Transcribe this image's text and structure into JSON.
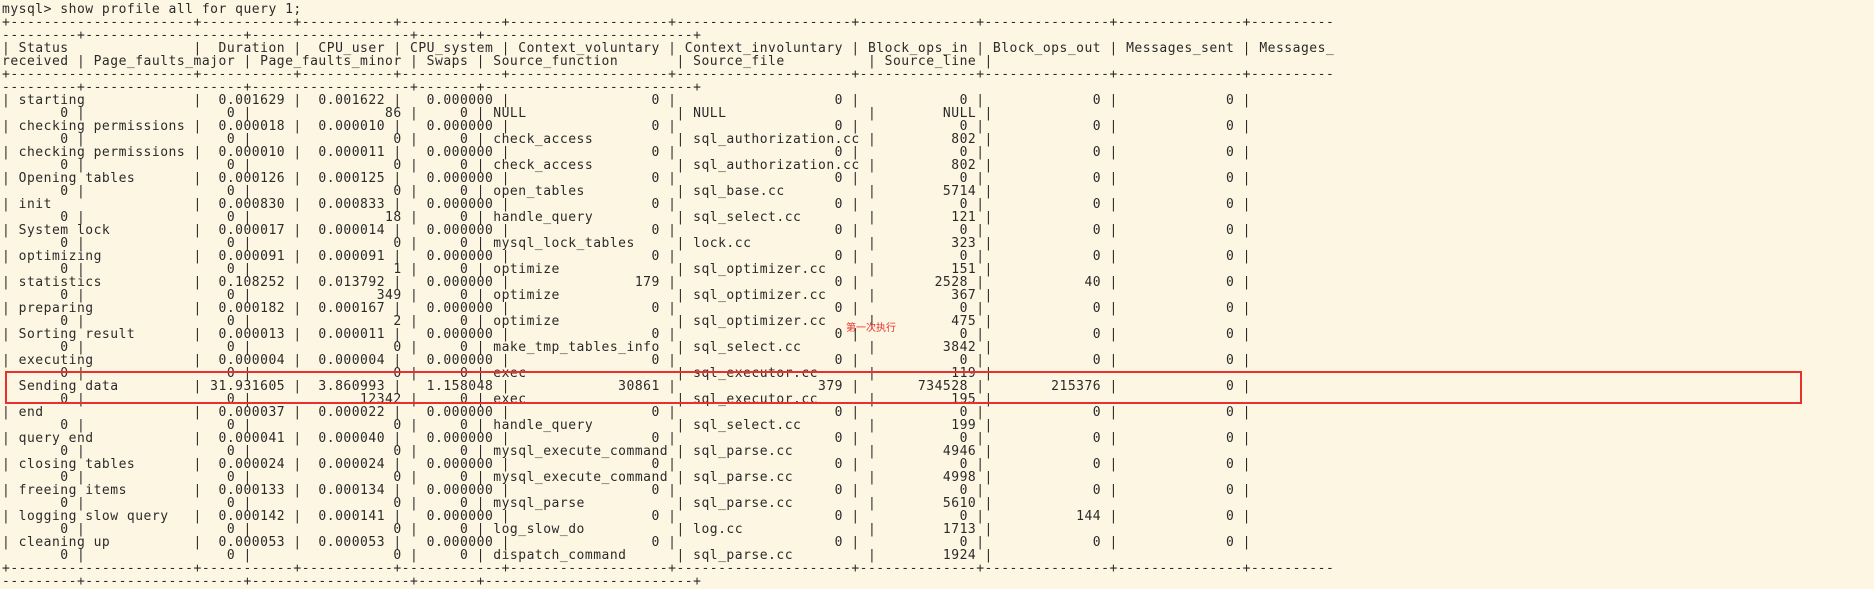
{
  "prompt": "mysql>",
  "command": "show profile all for query 1;",
  "separator": "+----------------------+-----------+-----------+------------+-------------------+---------------------+--------------+---------------+---------------+-------------------+-------------------+-------------------+-------+-------------------------+",
  "headers": [
    "Status",
    "Duration",
    "CPU_user",
    "CPU_system",
    "Context_voluntary",
    "Context_involuntary",
    "Block_ops_in",
    "Block_ops_out",
    "Messages_sent",
    "Messages_received",
    "Page_faults_major",
    "Page_faults_minor",
    "Swaps",
    "Source_function",
    "Source_file",
    "Source_line"
  ],
  "rows": [
    {
      "status": "starting",
      "duration": "0.001629",
      "cpu_user": "0.001622",
      "cpu_system": "0.000000",
      "ctx_vol": "0",
      "ctx_invol": "0",
      "block_in": "0",
      "block_out": "0",
      "msg_sent": "0",
      "msg_recv": "0",
      "pf_major": "0",
      "pf_minor": "86",
      "swaps": "0",
      "source_function": "NULL",
      "source_file": "NULL",
      "source_line": "NULL"
    },
    {
      "status": "checking permissions",
      "duration": "0.000018",
      "cpu_user": "0.000010",
      "cpu_system": "0.000000",
      "ctx_vol": "0",
      "ctx_invol": "0",
      "block_in": "0",
      "block_out": "0",
      "msg_sent": "0",
      "msg_recv": "0",
      "pf_major": "0",
      "pf_minor": "0",
      "swaps": "0",
      "source_function": "check_access",
      "source_file": "sql_authorization.cc",
      "source_line": "802"
    },
    {
      "status": "checking permissions",
      "duration": "0.000010",
      "cpu_user": "0.000011",
      "cpu_system": "0.000000",
      "ctx_vol": "0",
      "ctx_invol": "0",
      "block_in": "0",
      "block_out": "0",
      "msg_sent": "0",
      "msg_recv": "0",
      "pf_major": "0",
      "pf_minor": "0",
      "swaps": "0",
      "source_function": "check_access",
      "source_file": "sql_authorization.cc",
      "source_line": "802"
    },
    {
      "status": "Opening tables",
      "duration": "0.000126",
      "cpu_user": "0.000125",
      "cpu_system": "0.000000",
      "ctx_vol": "0",
      "ctx_invol": "0",
      "block_in": "0",
      "block_out": "0",
      "msg_sent": "0",
      "msg_recv": "0",
      "pf_major": "0",
      "pf_minor": "0",
      "swaps": "0",
      "source_function": "open_tables",
      "source_file": "sql_base.cc",
      "source_line": "5714"
    },
    {
      "status": "init",
      "duration": "0.000830",
      "cpu_user": "0.000833",
      "cpu_system": "0.000000",
      "ctx_vol": "0",
      "ctx_invol": "0",
      "block_in": "0",
      "block_out": "0",
      "msg_sent": "0",
      "msg_recv": "0",
      "pf_major": "0",
      "pf_minor": "18",
      "swaps": "0",
      "source_function": "handle_query",
      "source_file": "sql_select.cc",
      "source_line": "121"
    },
    {
      "status": "System lock",
      "duration": "0.000017",
      "cpu_user": "0.000014",
      "cpu_system": "0.000000",
      "ctx_vol": "0",
      "ctx_invol": "0",
      "block_in": "0",
      "block_out": "0",
      "msg_sent": "0",
      "msg_recv": "0",
      "pf_major": "0",
      "pf_minor": "0",
      "swaps": "0",
      "source_function": "mysql_lock_tables",
      "source_file": "lock.cc",
      "source_line": "323"
    },
    {
      "status": "optimizing",
      "duration": "0.000091",
      "cpu_user": "0.000091",
      "cpu_system": "0.000000",
      "ctx_vol": "0",
      "ctx_invol": "0",
      "block_in": "0",
      "block_out": "0",
      "msg_sent": "0",
      "msg_recv": "0",
      "pf_major": "0",
      "pf_minor": "1",
      "swaps": "0",
      "source_function": "optimize",
      "source_file": "sql_optimizer.cc",
      "source_line": "151"
    },
    {
      "status": "statistics",
      "duration": "0.108252",
      "cpu_user": "0.013792",
      "cpu_system": "0.000000",
      "ctx_vol": "179",
      "ctx_invol": "0",
      "block_in": "2528",
      "block_out": "40",
      "msg_sent": "0",
      "msg_recv": "0",
      "pf_major": "0",
      "pf_minor": "349",
      "swaps": "0",
      "source_function": "optimize",
      "source_file": "sql_optimizer.cc",
      "source_line": "367"
    },
    {
      "status": "preparing",
      "duration": "0.000182",
      "cpu_user": "0.000167",
      "cpu_system": "0.000000",
      "ctx_vol": "0",
      "ctx_invol": "0",
      "block_in": "0",
      "block_out": "0",
      "msg_sent": "0",
      "msg_recv": "0",
      "pf_major": "0",
      "pf_minor": "2",
      "swaps": "0",
      "source_function": "optimize",
      "source_file": "sql_optimizer.cc",
      "source_line": "475"
    },
    {
      "status": "Sorting result",
      "duration": "0.000013",
      "cpu_user": "0.000011",
      "cpu_system": "0.000000",
      "ctx_vol": "0",
      "ctx_invol": "0",
      "block_in": "0",
      "block_out": "0",
      "msg_sent": "0",
      "msg_recv": "0",
      "pf_major": "0",
      "pf_minor": "0",
      "swaps": "0",
      "source_function": "make_tmp_tables_info",
      "source_file": "sql_select.cc",
      "source_line": "3842"
    },
    {
      "status": "executing",
      "duration": "0.000004",
      "cpu_user": "0.000004",
      "cpu_system": "0.000000",
      "ctx_vol": "0",
      "ctx_invol": "0",
      "block_in": "0",
      "block_out": "0",
      "msg_sent": "0",
      "msg_recv": "0",
      "pf_major": "0",
      "pf_minor": "0",
      "swaps": "0",
      "source_function": "exec",
      "source_file": "sql_executor.cc",
      "source_line": "119"
    },
    {
      "status": "Sending data",
      "duration": "31.931605",
      "cpu_user": "3.860993",
      "cpu_system": "1.158048",
      "ctx_vol": "30861",
      "ctx_invol": "379",
      "block_in": "734528",
      "block_out": "215376",
      "msg_sent": "0",
      "msg_recv": "0",
      "pf_major": "0",
      "pf_minor": "12342",
      "swaps": "0",
      "source_function": "exec",
      "source_file": "sql_executor.cc",
      "source_line": "195"
    },
    {
      "status": "end",
      "duration": "0.000037",
      "cpu_user": "0.000022",
      "cpu_system": "0.000000",
      "ctx_vol": "0",
      "ctx_invol": "0",
      "block_in": "0",
      "block_out": "0",
      "msg_sent": "0",
      "msg_recv": "0",
      "pf_major": "0",
      "pf_minor": "0",
      "swaps": "0",
      "source_function": "handle_query",
      "source_file": "sql_select.cc",
      "source_line": "199"
    },
    {
      "status": "query end",
      "duration": "0.000041",
      "cpu_user": "0.000040",
      "cpu_system": "0.000000",
      "ctx_vol": "0",
      "ctx_invol": "0",
      "block_in": "0",
      "block_out": "0",
      "msg_sent": "0",
      "msg_recv": "0",
      "pf_major": "0",
      "pf_minor": "0",
      "swaps": "0",
      "source_function": "mysql_execute_command",
      "source_file": "sql_parse.cc",
      "source_line": "4946"
    },
    {
      "status": "closing tables",
      "duration": "0.000024",
      "cpu_user": "0.000024",
      "cpu_system": "0.000000",
      "ctx_vol": "0",
      "ctx_invol": "0",
      "block_in": "0",
      "block_out": "0",
      "msg_sent": "0",
      "msg_recv": "0",
      "pf_major": "0",
      "pf_minor": "0",
      "swaps": "0",
      "source_function": "mysql_execute_command",
      "source_file": "sql_parse.cc",
      "source_line": "4998"
    },
    {
      "status": "freeing items",
      "duration": "0.000133",
      "cpu_user": "0.000134",
      "cpu_system": "0.000000",
      "ctx_vol": "0",
      "ctx_invol": "0",
      "block_in": "0",
      "block_out": "0",
      "msg_sent": "0",
      "msg_recv": "0",
      "pf_major": "0",
      "pf_minor": "0",
      "swaps": "0",
      "source_function": "mysql_parse",
      "source_file": "sql_parse.cc",
      "source_line": "5610"
    },
    {
      "status": "logging slow query",
      "duration": "0.000142",
      "cpu_user": "0.000141",
      "cpu_system": "0.000000",
      "ctx_vol": "0",
      "ctx_invol": "0",
      "block_in": "0",
      "block_out": "144",
      "msg_sent": "0",
      "msg_recv": "0",
      "pf_major": "0",
      "pf_minor": "0",
      "swaps": "0",
      "source_function": "log_slow_do",
      "source_file": "log.cc",
      "source_line": "1713"
    },
    {
      "status": "cleaning up",
      "duration": "0.000053",
      "cpu_user": "0.000053",
      "cpu_system": "0.000000",
      "ctx_vol": "0",
      "ctx_invol": "0",
      "block_in": "0",
      "block_out": "0",
      "msg_sent": "0",
      "msg_recv": "0",
      "pf_major": "0",
      "pf_minor": "0",
      "swaps": "0",
      "source_function": "dispatch_command",
      "source_file": "sql_parse.cc",
      "source_line": "1924"
    }
  ],
  "annotation": "第一次执行",
  "colors": {
    "background": "#fdf6e3",
    "text": "#2a2a2a",
    "highlight": "#e8312f"
  }
}
